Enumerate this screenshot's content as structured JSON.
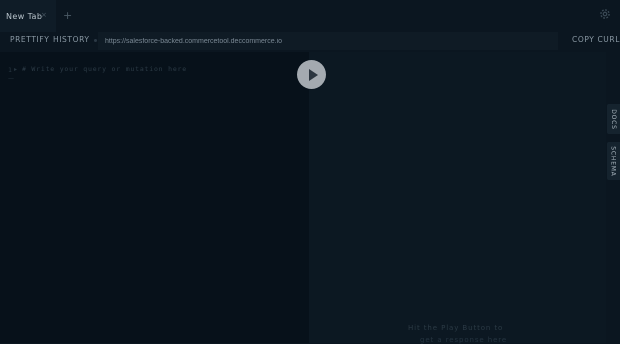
{
  "tabs": [
    {
      "label": "New Tab"
    }
  ],
  "tab_close_glyph": "×",
  "tab_add_glyph": "+",
  "icons": {
    "settings": "gear-icon",
    "play": "play-icon",
    "close": "close-icon",
    "add": "plus-icon"
  },
  "toolbar": {
    "prettify_label": "PRETTIFY",
    "history_label": "HISTORY",
    "url_value": "https://salesforce-backed.commercetool.deccommerce.io",
    "copy_curl_label": "COPY CURL"
  },
  "editor": {
    "line_number": "1",
    "fold_glyph": "▸",
    "code_text": "# Write your query or mutation here",
    "line2_glyph": "—"
  },
  "result": {
    "hint_line1": "Hit the Play Button to",
    "hint_line2": "get a response here"
  },
  "side_tabs": {
    "docs_label": "DOCS",
    "schema_label": "SCHEMA"
  },
  "colors": {
    "background": "#0b1620",
    "editor_bg": "#07111a",
    "result_bg": "#0c1822",
    "play_button": "#a4aab0"
  }
}
